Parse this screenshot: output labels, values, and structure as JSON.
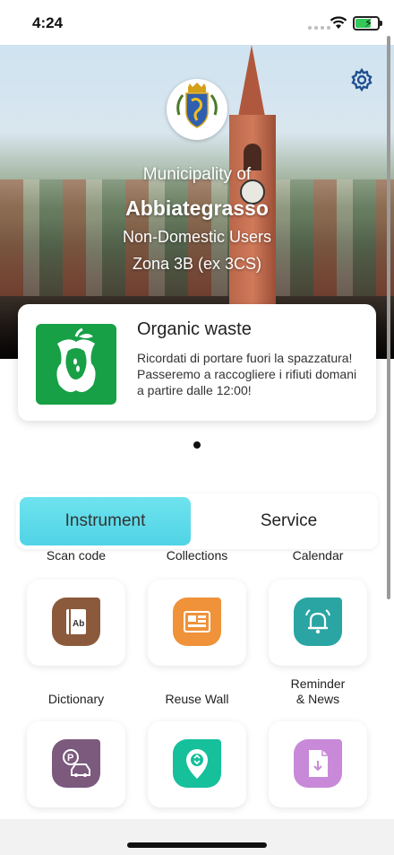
{
  "status_bar": {
    "time": "4:24"
  },
  "header": {
    "municipality_label": "Municipality of",
    "city": "Abbiategrasso",
    "user_type": "Non-Domestic Users",
    "zone": "Zona 3B (ex 3CS)",
    "settings_icon": "gear-icon",
    "crest_icon": "municipal-crest-icon"
  },
  "notification": {
    "title": "Organic waste",
    "message": "Ricordati di portare fuori la spazzatura!\nPasseremo a raccogliere i rifiuti domani a partire dalle 12:00!",
    "icon": "apple-core-icon",
    "icon_color": "#17a046"
  },
  "tabs": [
    {
      "label": "Instrument",
      "selected": true
    },
    {
      "label": "Service",
      "selected": false
    }
  ],
  "tiles": [
    {
      "label": "Scan code",
      "icon": "book-icon",
      "color": "#8b5a3c"
    },
    {
      "label": "Collections",
      "icon": "calendar-board-icon",
      "color": "#f0923a"
    },
    {
      "label": "Calendar",
      "icon": "bell-icon",
      "color": "#2aa5a3"
    },
    {
      "label": "Dictionary",
      "icon": "parking-car-icon",
      "color": "#7b5a7e"
    },
    {
      "label": "Reuse Wall",
      "icon": "recycle-pin-icon",
      "color": "#16c09b"
    },
    {
      "label": "Reminder\n& News",
      "icon": "download-document-icon",
      "color": "#c889d8"
    }
  ],
  "colors": {
    "tab_active": "#4fd3e6",
    "accent": "#1f4f8f"
  }
}
